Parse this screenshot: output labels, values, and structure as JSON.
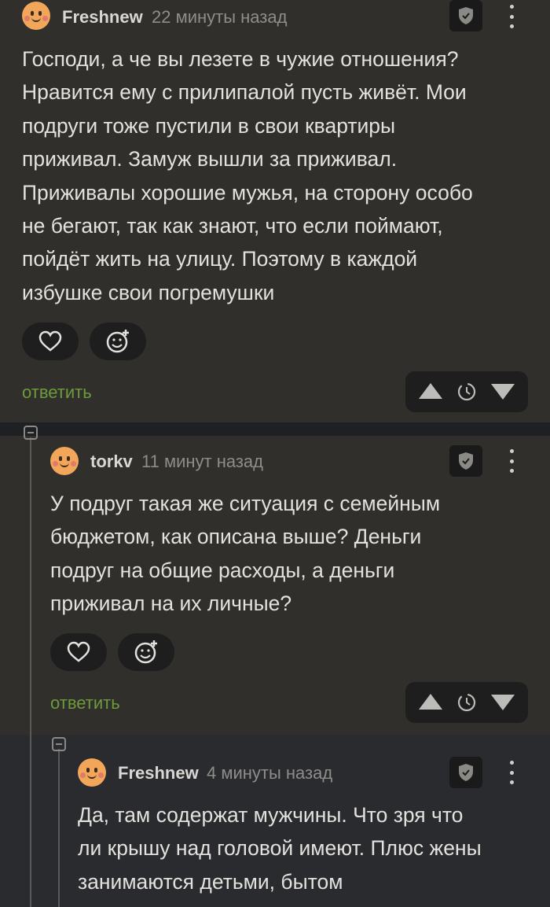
{
  "comments": [
    {
      "author": "Freshnew",
      "time": "22 минуты назад",
      "text": [
        "Господи, а че вы лезете в чужие отношения?",
        "Нравится ему с прилипалой пусть живёт. Мои",
        "подруги тоже пустили в свои квартиры",
        "приживал. Замуж вышли за приживал.",
        "Приживалы хорошие мужья, на сторону особо",
        "не бегают, так как знают, что если поймают,",
        "пойдёт жить на улицу. Поэтому в каждой",
        "избушке свои погремушки"
      ],
      "reply_label": "ответить"
    },
    {
      "author": "torkv",
      "time": "11 минут назад",
      "text": [
        "У подруг такая же ситуация с семейным",
        "бюджетом, как описана выше? Деньги",
        "подруг на общие расходы, а деньги",
        "приживал на их личные?"
      ],
      "reply_label": "ответить"
    },
    {
      "author": "Freshnew",
      "time": "4 минуты назад",
      "text": [
        "Да, там содержат мужчины. Что зря что",
        "ли крышу над головой имеют. Плюс жены",
        "занимаются детьми, бытом"
      ]
    }
  ],
  "icons": {
    "like": "heart-icon",
    "emoji": "add-emoji-icon",
    "shield": "shield-check-icon",
    "menu": "more-vertical-icon",
    "upvote": "arrow-up-icon",
    "downvote": "arrow-down-icon",
    "rating_pending": "clock-icon",
    "collapse": "collapse-thread-icon"
  },
  "colors": {
    "background": "#302f2b",
    "reply_link": "#6d9a3d",
    "avatar": "#f2a65a"
  }
}
